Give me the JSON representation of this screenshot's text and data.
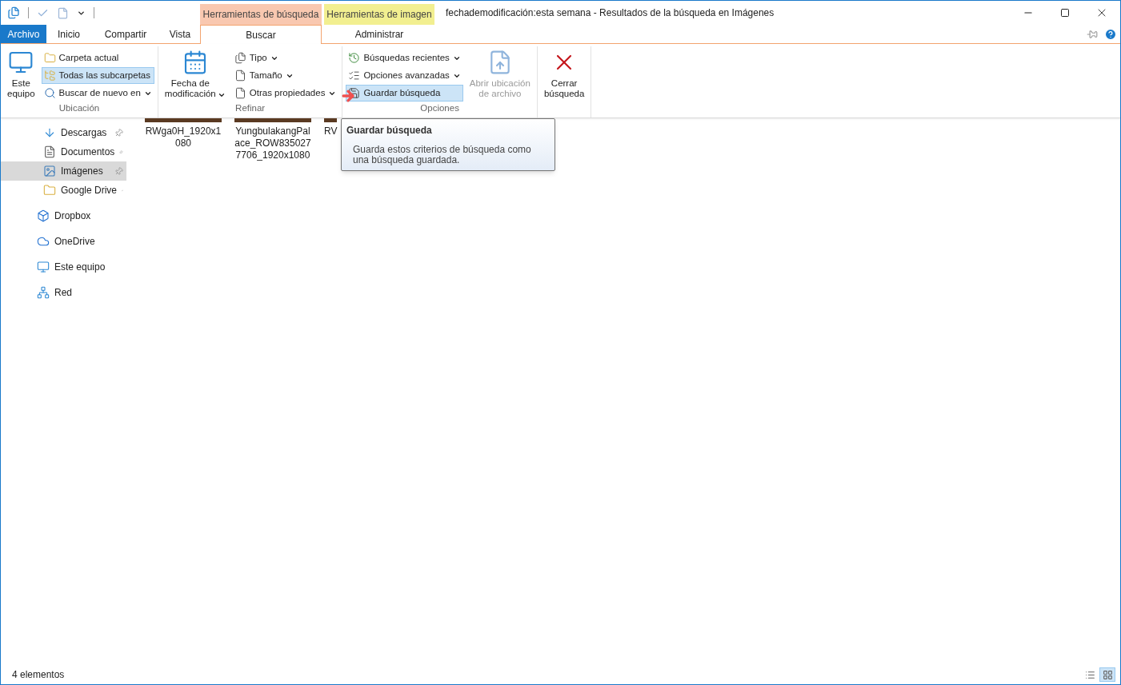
{
  "context_tabs": [
    {
      "label": "Herramientas de búsqueda",
      "color": "#f9c8b0"
    },
    {
      "label": "Herramientas de imagen",
      "color": "#f2ef90"
    }
  ],
  "window": {
    "title": "fechademodificación:esta semana - Resultados de la búsqueda en Imágenes"
  },
  "ribbon_tabs": [
    {
      "label": "Archivo",
      "kind": "file",
      "selected": false
    },
    {
      "label": "Inicio",
      "kind": "tab",
      "selected": false
    },
    {
      "label": "Compartir",
      "kind": "tab",
      "selected": false
    },
    {
      "label": "Vista",
      "kind": "tab",
      "selected": false
    },
    {
      "label": "Buscar",
      "kind": "tab",
      "selected": true
    },
    {
      "label": "Administrar",
      "kind": "tab",
      "selected": false
    }
  ],
  "ribbon_groups": [
    {
      "label": "Ubicación",
      "items": [
        {
          "kind": "computer",
          "label": "Este\nequipo",
          "dropdown": false,
          "disabled": false
        },
        {
          "kind": "folder",
          "label": "Carpeta actual",
          "dropdown": false,
          "selected": false
        },
        {
          "kind": "subfolders",
          "label": "Todas las subcarpetas",
          "dropdown": false,
          "selected": true
        },
        {
          "kind": "search",
          "label": "Buscar de nuevo en",
          "dropdown": true,
          "selected": false
        }
      ]
    },
    {
      "label": "Refinar",
      "items": [
        {
          "kind": "calendar",
          "label": "Fecha de\nmodificación",
          "dropdown": true,
          "disabled": false
        },
        {
          "kind": "type",
          "label": "Tipo",
          "dropdown": true,
          "selected": false
        },
        {
          "kind": "size",
          "label": "Tamaño",
          "dropdown": true,
          "selected": false
        },
        {
          "kind": "properties",
          "label": "Otras propiedades",
          "dropdown": true,
          "selected": false
        }
      ]
    },
    {
      "label": "Opciones",
      "items": [
        {
          "kind": "recent",
          "label": "Búsquedas recientes",
          "dropdown": true,
          "selected": false
        },
        {
          "kind": "advanced",
          "label": "Opciones avanzadas",
          "dropdown": true,
          "selected": false
        },
        {
          "kind": "save",
          "label": "Guardar búsqueda",
          "dropdown": false,
          "selected": true
        },
        {
          "kind": "open-location",
          "label": "Abrir ubicación\nde archivo",
          "dropdown": false,
          "disabled": true
        }
      ]
    },
    {
      "items": [
        {
          "kind": "close",
          "label": "Cerrar\nbúsqueda",
          "dropdown": false,
          "disabled": false
        }
      ]
    }
  ],
  "nav": {
    "quick_access": [
      {
        "label": "Descargas",
        "kind": "download",
        "pinned": true,
        "selected": false
      },
      {
        "label": "Documentos",
        "kind": "document",
        "pinned": true,
        "selected": false
      },
      {
        "label": "Imágenes",
        "kind": "pictures",
        "pinned": true,
        "selected": true
      },
      {
        "label": "Google Drive",
        "kind": "folder",
        "pinned": true,
        "selected": false
      }
    ],
    "locations": [
      {
        "label": "Dropbox",
        "kind": "dropbox",
        "selected": false
      },
      {
        "label": "OneDrive",
        "kind": "onedrive",
        "selected": false
      },
      {
        "label": "Este equipo",
        "kind": "computer",
        "selected": false
      },
      {
        "label": "Red",
        "kind": "network",
        "selected": false
      }
    ]
  },
  "files": [
    {
      "name": "RWga0H_1920x1080"
    },
    {
      "name": "YungbulakangPalace_ROW8350277706_1920x1080"
    },
    {
      "name": "RV"
    }
  ],
  "tooltip": {
    "title": "Guardar búsqueda",
    "text": "Guarda estos criterios de búsqueda como una búsqueda guardada."
  },
  "status_bar": {
    "count": "4 elementos"
  },
  "view_modes": [
    {
      "kind": "details",
      "selected": false
    },
    {
      "kind": "large-icons",
      "selected": true
    }
  ]
}
